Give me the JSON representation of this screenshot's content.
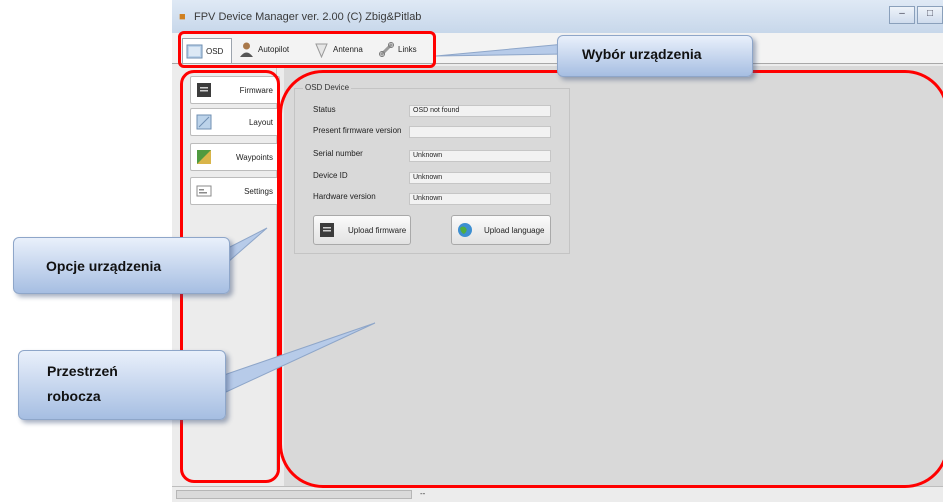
{
  "window": {
    "title": "FPV Device Manager ver. 2.00 (C) Zbig&Pitlab",
    "icon": "app-icon",
    "controls": [
      "minimize",
      "maximize"
    ]
  },
  "tabs": [
    {
      "label": "OSD",
      "icon": "osd-icon",
      "active": true
    },
    {
      "label": "Autopilot",
      "icon": "pilot-icon",
      "active": false
    },
    {
      "label": "Antenna",
      "icon": "antenna-icon",
      "active": false
    },
    {
      "label": "Links",
      "icon": "link-icon",
      "active": false
    }
  ],
  "sidebar": {
    "items": [
      {
        "label": "Firmware",
        "icon": "chip-icon",
        "selected": true
      },
      {
        "label": "Layout",
        "icon": "layout-icon",
        "selected": false
      },
      {
        "label": "Waypoints",
        "icon": "map-icon",
        "selected": false
      },
      {
        "label": "Settings",
        "icon": "settings-icon",
        "selected": false
      }
    ]
  },
  "device": {
    "group_title": "OSD Device",
    "rows": [
      {
        "label": "Status",
        "value": "OSD not found"
      },
      {
        "label": "Present firmware version",
        "value": ""
      },
      {
        "label": "Serial number",
        "value": "Unknown"
      },
      {
        "label": "Device ID",
        "value": "Unknown"
      },
      {
        "label": "Hardware version",
        "value": "Unknown"
      }
    ],
    "upload_firmware_label": "Upload firmware",
    "upload_language_label": "Upload language"
  },
  "statusbar": {
    "text": "--"
  },
  "annotations": {
    "device_select": "Wybór urządzenia",
    "device_options": "Opcje urządzenia",
    "workspace_line1": "Przestrzeń",
    "workspace_line2": "robocza",
    "color": "#ff0000"
  }
}
